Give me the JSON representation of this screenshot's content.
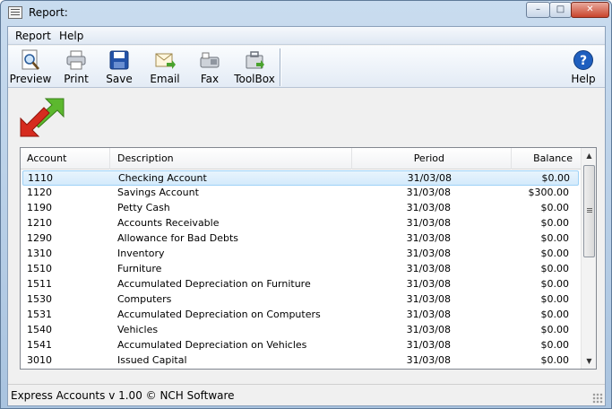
{
  "window": {
    "title": "Report:",
    "controls": {
      "minimize": "–",
      "maximize": "□",
      "close": "✕"
    }
  },
  "menu": [
    "Report",
    "Help"
  ],
  "toolbar": {
    "preview": "Preview",
    "print": "Print",
    "save": "Save",
    "email": "Email",
    "fax": "Fax",
    "toolbox": "ToolBox",
    "help": "Help"
  },
  "table": {
    "columns": {
      "account": "Account",
      "description": "Description",
      "period": "Period",
      "balance": "Balance"
    },
    "rows": [
      {
        "account": "1110",
        "description": "Checking Account",
        "period": "31/03/08",
        "balance": "$0.00",
        "selected": true
      },
      {
        "account": "1120",
        "description": "Savings Account",
        "period": "31/03/08",
        "balance": "$300.00"
      },
      {
        "account": "1190",
        "description": "Petty Cash",
        "period": "31/03/08",
        "balance": "$0.00"
      },
      {
        "account": "1210",
        "description": "Accounts Receivable",
        "period": "31/03/08",
        "balance": "$0.00"
      },
      {
        "account": "1290",
        "description": "Allowance for Bad Debts",
        "period": "31/03/08",
        "balance": "$0.00"
      },
      {
        "account": "1310",
        "description": "Inventory",
        "period": "31/03/08",
        "balance": "$0.00"
      },
      {
        "account": "1510",
        "description": "Furniture",
        "period": "31/03/08",
        "balance": "$0.00"
      },
      {
        "account": "1511",
        "description": "Accumulated Depreciation on Furniture",
        "period": "31/03/08",
        "balance": "$0.00"
      },
      {
        "account": "1530",
        "description": "Computers",
        "period": "31/03/08",
        "balance": "$0.00"
      },
      {
        "account": "1531",
        "description": "Accumulated Depreciation on Computers",
        "period": "31/03/08",
        "balance": "$0.00"
      },
      {
        "account": "1540",
        "description": "Vehicles",
        "period": "31/03/08",
        "balance": "$0.00"
      },
      {
        "account": "1541",
        "description": "Accumulated Depreciation on Vehicles",
        "period": "31/03/08",
        "balance": "$0.00"
      },
      {
        "account": "3010",
        "description": "Issued Capital",
        "period": "31/03/08",
        "balance": "$0.00"
      }
    ]
  },
  "status": {
    "text": "Express Accounts v 1.00 © NCH Software"
  },
  "colors": {
    "selection": "#d4eafb",
    "selection_border": "#9dd1f6",
    "help_blue": "#1f5fbf",
    "arrow_green": "#5cb82e",
    "arrow_red": "#d62b1f"
  }
}
